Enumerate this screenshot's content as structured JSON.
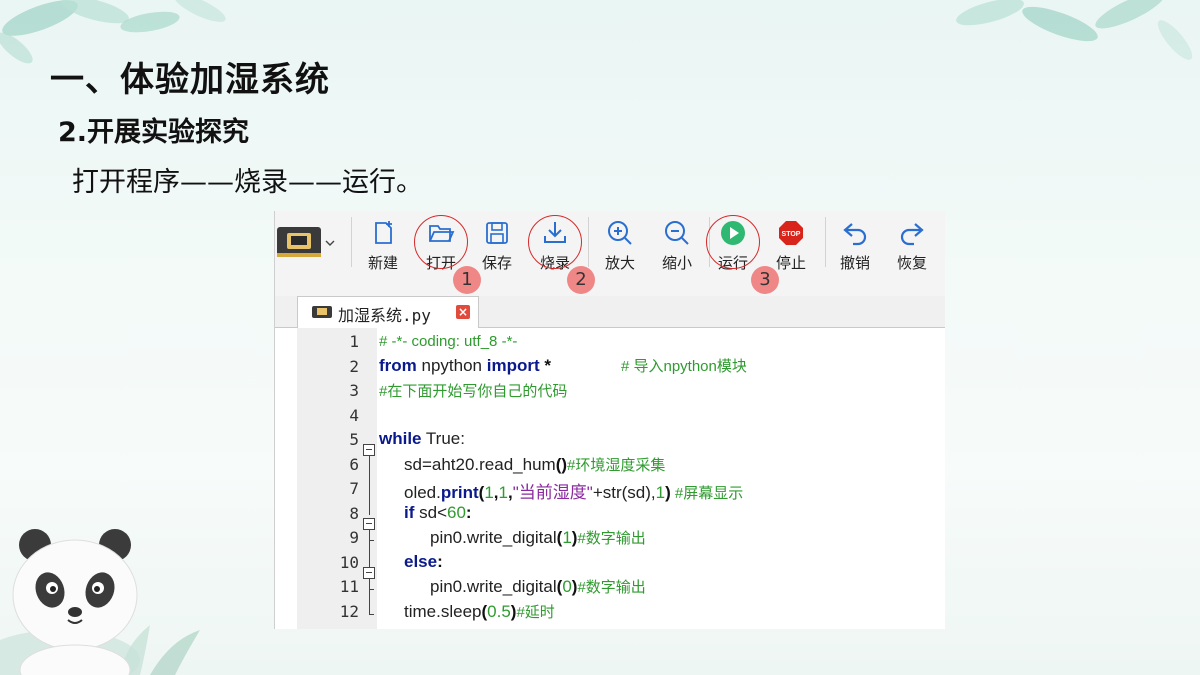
{
  "slide": {
    "title": "一、体验加湿系统",
    "subtitle": "2.开展实验探究",
    "body": "打开程序——烧录——运行。"
  },
  "toolbar": {
    "buttons": [
      {
        "id": "new",
        "label": "新建",
        "icon": "new-file-icon"
      },
      {
        "id": "open",
        "label": "打开",
        "icon": "folder-open-icon"
      },
      {
        "id": "save",
        "label": "保存",
        "icon": "save-icon"
      },
      {
        "id": "flash",
        "label": "烧录",
        "icon": "download-icon"
      },
      {
        "id": "zoom_in",
        "label": "放大",
        "icon": "zoom-in-icon"
      },
      {
        "id": "zoom_out",
        "label": "缩小",
        "icon": "zoom-out-icon"
      },
      {
        "id": "run",
        "label": "运行",
        "icon": "play-icon"
      },
      {
        "id": "stop",
        "label": "停止",
        "icon": "stop-sign-icon"
      },
      {
        "id": "undo",
        "label": "撤销",
        "icon": "undo-icon"
      },
      {
        "id": "redo",
        "label": "恢复",
        "icon": "redo-icon"
      }
    ],
    "stop_sign_text": "STOP",
    "steps": [
      "1",
      "2",
      "3"
    ]
  },
  "tab": {
    "filename": "加湿系统.py",
    "close": "×"
  },
  "code": {
    "line_numbers": [
      "1",
      "2",
      "3",
      "4",
      "5",
      "6",
      "7",
      "8",
      "9",
      "10",
      "11",
      "12"
    ],
    "l1": "# -*- coding: utf_8 -*-",
    "l2_kw1": "from",
    "l2_mod": " npython ",
    "l2_kw2": "import",
    "l2_star": " *",
    "l2_cm": "# 导入npython模块",
    "l3": "#在下面开始写你自己的代码",
    "l5_kw": "while",
    "l5_rest": " True:",
    "l6_a": "sd=aht20.read_hum",
    "l6_p": "()",
    "l6_cm": "#环境湿度采集",
    "l7_a": "oled.",
    "l7_fn": "print",
    "l7_p1": "(",
    "l7_n1": "1",
    "l7_c1": ",",
    "l7_n2": "1",
    "l7_c2": ",",
    "l7_s": "\"当前湿度\"",
    "l7_b": "+str(sd),",
    "l7_n3": "1",
    "l7_p2": ")",
    "l7_cm": " #屏幕显示",
    "l8_kw": "if",
    "l8_a": " sd<",
    "l8_n": "60",
    "l8_b": ":",
    "l9_a": "pin0.write_digital",
    "l9_p1": "(",
    "l9_n": "1",
    "l9_p2": ")",
    "l9_cm": "#数字输出",
    "l10_kw": "else",
    "l10_b": ":",
    "l11_a": "pin0.write_digital",
    "l11_p1": "(",
    "l11_n": "0",
    "l11_p2": ")",
    "l11_cm": "#数字输出",
    "l12_a": "time.sleep",
    "l12_p1": "(",
    "l12_n": "0.5",
    "l12_p2": ")",
    "l12_cm": "#延时"
  }
}
